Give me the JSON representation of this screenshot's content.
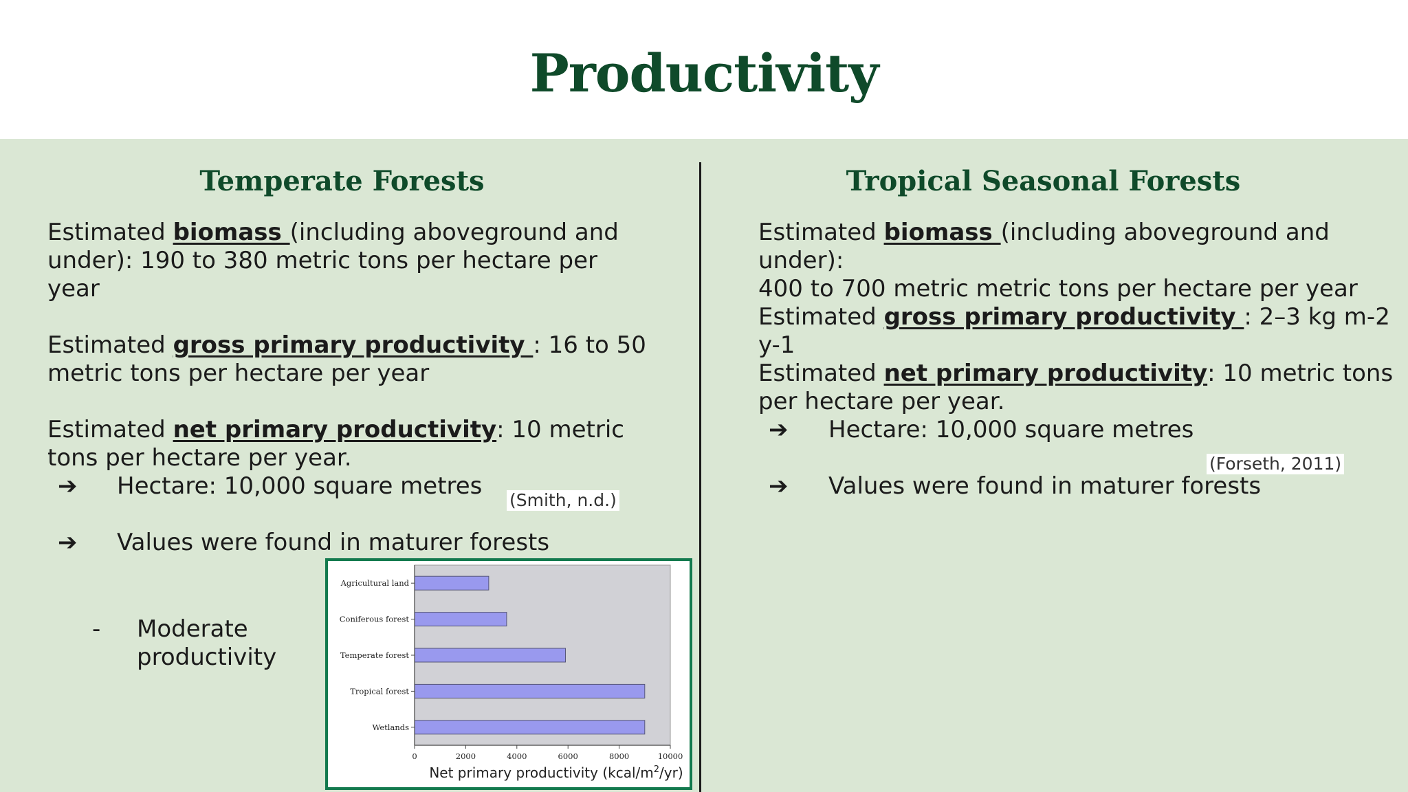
{
  "slide": {
    "title": "Productivity"
  },
  "left": {
    "heading": "Temperate Forests",
    "p1": {
      "pre": "Estimated ",
      "term": "biomass ",
      "line1_rest": "(including aboveground and",
      "line2": "under): 190 to 380 metric tons per hectare per",
      "line3": "year"
    },
    "p2": {
      "pre": "Estimated ",
      "term": "gross primary productivity ",
      "line1_rest": ": 16 to 50",
      "line2": "metric tons per hectare per year"
    },
    "p3": {
      "pre": "Estimated ",
      "term": "net primary productivity",
      "line1_rest": ": 10 metric",
      "line2": "tons per hectare per year."
    },
    "arrow_symbol": "➔",
    "bullets": [
      "Hectare: 10,000 square metres",
      "Values were found in maturer forests"
    ],
    "sub_dash": "-",
    "sub_line1": "Moderate",
    "sub_line2": "productivity",
    "citation": "(Smith, n.d.)"
  },
  "right": {
    "heading": "Tropical Seasonal Forests",
    "p1": {
      "pre": "Estimated ",
      "term": "biomass ",
      "line1_rest": "(including aboveground and under):",
      "line2": "400 to 700 metric metric tons per hectare per year"
    },
    "p2": {
      "pre": "Estimated ",
      "term": "gross primary productivity ",
      "line1_rest": ": 2–3 kg m-2 y-1"
    },
    "p3": {
      "pre": "Estimated ",
      "term": "net primary productivity",
      "line1_rest": ": 10 metric tons",
      "line2": "per hectare per year."
    },
    "arrow_symbol": "➔",
    "bullets": [
      "Hectare: 10,000 square metres",
      "Values were found in maturer forests"
    ],
    "citation": "(Forseth, 2011)"
  },
  "chart_data": {
    "type": "bar",
    "orientation": "horizontal",
    "categories": [
      "Agricultural land",
      "Coniferous forest",
      "Temperate forest",
      "Tropical forest",
      "Wetlands"
    ],
    "values": [
      2900,
      3600,
      5900,
      9000,
      9000
    ],
    "xlabel_main": "Net primary productivity (kcal/m",
    "xlabel_sup": "2",
    "xlabel_end": "/yr)",
    "xlim": [
      0,
      10000
    ],
    "xticks": [
      "0",
      "2000",
      "4000",
      "6000",
      "8000",
      "10000"
    ],
    "xtick_values": [
      0,
      2000,
      4000,
      6000,
      8000,
      10000
    ],
    "bar_color": "#9999ee",
    "plot_background": "#d1d1d6",
    "grid": false
  }
}
